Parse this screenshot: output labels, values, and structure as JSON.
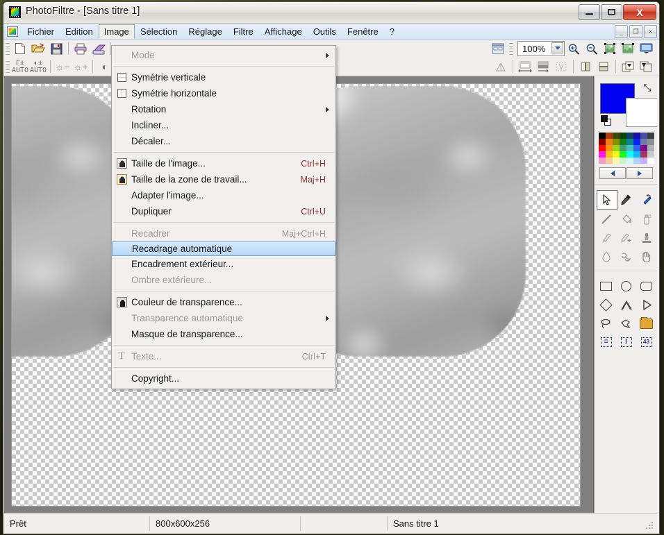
{
  "window": {
    "title": "PhotoFiltre - [Sans titre 1]",
    "app_icon": "photofiltre-icon",
    "controls": {
      "minimize": "–",
      "maximize": "□",
      "close": "X"
    }
  },
  "mdi_controls": {
    "minimize": "_",
    "restore": "❐",
    "close": "×"
  },
  "menubar": {
    "items": [
      {
        "label": "Fichier",
        "open": false
      },
      {
        "label": "Edition",
        "open": false
      },
      {
        "label": "Image",
        "open": true
      },
      {
        "label": "Sélection",
        "open": false
      },
      {
        "label": "Réglage",
        "open": false
      },
      {
        "label": "Filtre",
        "open": false
      },
      {
        "label": "Affichage",
        "open": false
      },
      {
        "label": "Outils",
        "open": false
      },
      {
        "label": "Fenêtre",
        "open": false
      },
      {
        "label": "?",
        "open": false
      }
    ]
  },
  "image_menu": {
    "items": [
      {
        "label": "Mode",
        "accel": "",
        "icon": "",
        "disabled": true,
        "submenu": true,
        "highlight": false
      },
      {
        "sep": true
      },
      {
        "label": "Symétrie verticale",
        "accel": "",
        "icon": "flip-vertical-icon",
        "disabled": false,
        "submenu": false,
        "highlight": false
      },
      {
        "label": "Symétrie horizontale",
        "accel": "",
        "icon": "flip-horizontal-icon",
        "disabled": false,
        "submenu": false,
        "highlight": false
      },
      {
        "label": "Rotation",
        "accel": "",
        "icon": "",
        "disabled": false,
        "submenu": true,
        "highlight": false
      },
      {
        "label": "Incliner...",
        "accel": "",
        "icon": "",
        "disabled": false,
        "submenu": false,
        "highlight": false
      },
      {
        "label": "Décaler...",
        "accel": "",
        "icon": "",
        "disabled": false,
        "submenu": false,
        "highlight": false
      },
      {
        "sep": true
      },
      {
        "label": "Taille de l'image...",
        "accel": "Ctrl+H",
        "icon": "image-size-icon",
        "disabled": false,
        "submenu": false,
        "highlight": false
      },
      {
        "label": "Taille de la zone de travail...",
        "accel": "Maj+H",
        "icon": "canvas-size-icon",
        "disabled": false,
        "submenu": false,
        "highlight": false
      },
      {
        "label": "Adapter l'image...",
        "accel": "",
        "icon": "",
        "disabled": false,
        "submenu": false,
        "highlight": false
      },
      {
        "label": "Dupliquer",
        "accel": "Ctrl+U",
        "icon": "",
        "disabled": false,
        "submenu": false,
        "highlight": false
      },
      {
        "sep": true
      },
      {
        "label": "Recadrer",
        "accel": "Maj+Ctrl+H",
        "icon": "",
        "disabled": true,
        "submenu": false,
        "highlight": false
      },
      {
        "label": "Recadrage automatique",
        "accel": "",
        "icon": "",
        "disabled": false,
        "submenu": false,
        "highlight": true
      },
      {
        "label": "Encadrement extérieur...",
        "accel": "",
        "icon": "",
        "disabled": false,
        "submenu": false,
        "highlight": false
      },
      {
        "label": "Ombre extérieure...",
        "accel": "",
        "icon": "",
        "disabled": true,
        "submenu": false,
        "highlight": false
      },
      {
        "sep": true
      },
      {
        "label": "Couleur de transparence...",
        "accel": "",
        "icon": "transparency-color-icon",
        "disabled": false,
        "submenu": false,
        "highlight": false
      },
      {
        "label": "Transparence automatique",
        "accel": "",
        "icon": "",
        "disabled": true,
        "submenu": true,
        "highlight": false
      },
      {
        "label": "Masque de transparence...",
        "accel": "",
        "icon": "",
        "disabled": false,
        "submenu": false,
        "highlight": false
      },
      {
        "sep": true
      },
      {
        "label": "Texte...",
        "accel": "Ctrl+T",
        "icon": "text-icon",
        "disabled": true,
        "submenu": false,
        "highlight": false
      },
      {
        "sep": true
      },
      {
        "label": "Copyright...",
        "accel": "",
        "icon": "",
        "disabled": false,
        "submenu": false,
        "highlight": false
      }
    ]
  },
  "toolbar_main": {
    "buttons": [
      {
        "name": "new-file-icon",
        "glyph": "🗋",
        "label": ""
      },
      {
        "name": "open-file-icon",
        "glyph": "📂",
        "label": ""
      },
      {
        "name": "save-file-icon",
        "glyph": "💾",
        "label": ""
      },
      {
        "sep": true
      },
      {
        "name": "print-icon",
        "glyph": "🖶",
        "label": ""
      },
      {
        "name": "scanner-icon",
        "glyph": "🖨",
        "label": ""
      }
    ],
    "right_buttons": [
      {
        "name": "thumbnail-browser-icon",
        "glyph": "🗔",
        "label": ""
      },
      {
        "name": "zoom-in-icon",
        "glyph": "🔍",
        "label": ""
      },
      {
        "name": "zoom-out-icon",
        "glyph": "🔍",
        "label": ""
      },
      {
        "name": "fit-image-icon",
        "glyph": "▣",
        "label": ""
      },
      {
        "name": "actual-size-icon",
        "glyph": "▣",
        "label": ""
      },
      {
        "name": "fullscreen-icon",
        "glyph": "🖵",
        "label": ""
      }
    ],
    "zoom": {
      "value": "100%",
      "placeholder": "100%"
    }
  },
  "toolbar_adjust": {
    "buttons": [
      {
        "name": "auto-gamma-icon",
        "glyph": "Γ±",
        "label": "AUTO"
      },
      {
        "name": "auto-contrast-icon",
        "glyph": "◐±",
        "label": "AUTO"
      },
      {
        "sep": true
      },
      {
        "name": "brightness-down-icon",
        "glyph": "☼−",
        "label": ""
      },
      {
        "name": "brightness-up-icon",
        "glyph": "☼+",
        "label": ""
      },
      {
        "sep": true
      },
      {
        "name": "contrast-down-icon",
        "glyph": "◐",
        "label": ""
      }
    ],
    "right_buttons": [
      {
        "name": "gradient-icon",
        "glyph": "◸",
        "label": ""
      },
      {
        "sep": true
      },
      {
        "name": "resize-width-icon",
        "glyph": "▭",
        "label": ""
      },
      {
        "name": "resize-canvas-icon",
        "glyph": "▬",
        "label": ""
      },
      {
        "name": "crop-icon",
        "glyph": "▩",
        "label": ""
      },
      {
        "sep": true
      },
      {
        "name": "flip-horizontal-icon",
        "glyph": "◫",
        "label": ""
      },
      {
        "name": "flip-vertical-icon",
        "glyph": "⊟",
        "label": ""
      },
      {
        "sep": true
      },
      {
        "name": "rotate-left-icon",
        "glyph": "⟲",
        "label": ""
      },
      {
        "name": "rotate-right-icon",
        "glyph": "⟳",
        "label": ""
      }
    ]
  },
  "color_panel": {
    "foreground": "#0000ee",
    "background": "#ffffff",
    "swap_icon": "swap-colors-icon",
    "reset_icon": "reset-colors-icon",
    "prev_label": "◀",
    "next_label": "▶",
    "palette": [
      "#000000",
      "#a83c10",
      "#3e4a06",
      "#0b4008",
      "#11406b",
      "#160f9e",
      "#4a4fa0",
      "#3a3f42",
      "#8a0000",
      "#f57b13",
      "#8a8f06",
      "#128012",
      "#0b8596",
      "#0a22f2",
      "#6f7ba6",
      "#8d9094",
      "#fb0808",
      "#f9961a",
      "#9bd318",
      "#3d9c70",
      "#41c4c0",
      "#3166e8",
      "#7d0b8e",
      "#adb0b4",
      "#fb18e8",
      "#fbc21a",
      "#f8fb18",
      "#1cf91c",
      "#19f8f6",
      "#16b7f6",
      "#a43a62",
      "#c9cbcd",
      "#f99bc6",
      "#fbc99b",
      "#f9f9b2",
      "#c9f5cb",
      "#d0f8f8",
      "#aed2f9",
      "#cbaef9",
      "#ffffff"
    ]
  },
  "tools_panel": {
    "row1": [
      {
        "name": "selection-arrow-tool",
        "selected": true
      },
      {
        "name": "eyedropper-tool",
        "selected": false
      },
      {
        "name": "magic-wand-tool",
        "selected": false
      }
    ],
    "row2": [
      {
        "name": "line-tool",
        "selected": false
      },
      {
        "name": "paint-bucket-tool",
        "selected": false
      },
      {
        "name": "spray-tool",
        "selected": false
      }
    ],
    "row3": [
      {
        "name": "brush-tool",
        "selected": false
      },
      {
        "name": "brush-plus-tool",
        "selected": false
      },
      {
        "name": "clone-stamp-tool",
        "selected": false
      }
    ],
    "row4": [
      {
        "name": "blur-drop-tool",
        "selected": false
      },
      {
        "name": "smudge-tool",
        "selected": false
      },
      {
        "name": "hand-tool",
        "selected": false
      }
    ],
    "shapes_row1": [
      {
        "name": "rectangle-select-tool",
        "selected": false
      },
      {
        "name": "ellipse-select-tool",
        "selected": false
      },
      {
        "name": "rounded-rect-select-tool",
        "selected": false
      }
    ],
    "shapes_row2": [
      {
        "name": "diamond-select-tool",
        "selected": false
      },
      {
        "name": "triangle-select-tool",
        "selected": false
      },
      {
        "name": "right-triangle-select-tool",
        "selected": false
      }
    ],
    "shapes_row3": [
      {
        "name": "lasso-select-tool",
        "selected": false
      },
      {
        "name": "polygon-select-tool",
        "selected": false
      },
      {
        "name": "load-selection-tool",
        "selected": false
      }
    ],
    "shapes_row4": [
      {
        "name": "selection-align-tool",
        "selected": false,
        "glyph": "≡"
      },
      {
        "name": "selection-center-tool",
        "selected": false,
        "glyph": "I"
      },
      {
        "name": "selection-size-tool",
        "selected": false,
        "glyph": "43"
      }
    ]
  },
  "statusbar": {
    "message": "Prêt",
    "dimensions": "800x600x256",
    "extra": "",
    "document": "Sans titre 1"
  },
  "canvas": {
    "transparency_checker": true,
    "shapes": [
      {
        "name": "blurred-gray-blob-left"
      },
      {
        "name": "blurred-gray-blob-right"
      }
    ]
  }
}
